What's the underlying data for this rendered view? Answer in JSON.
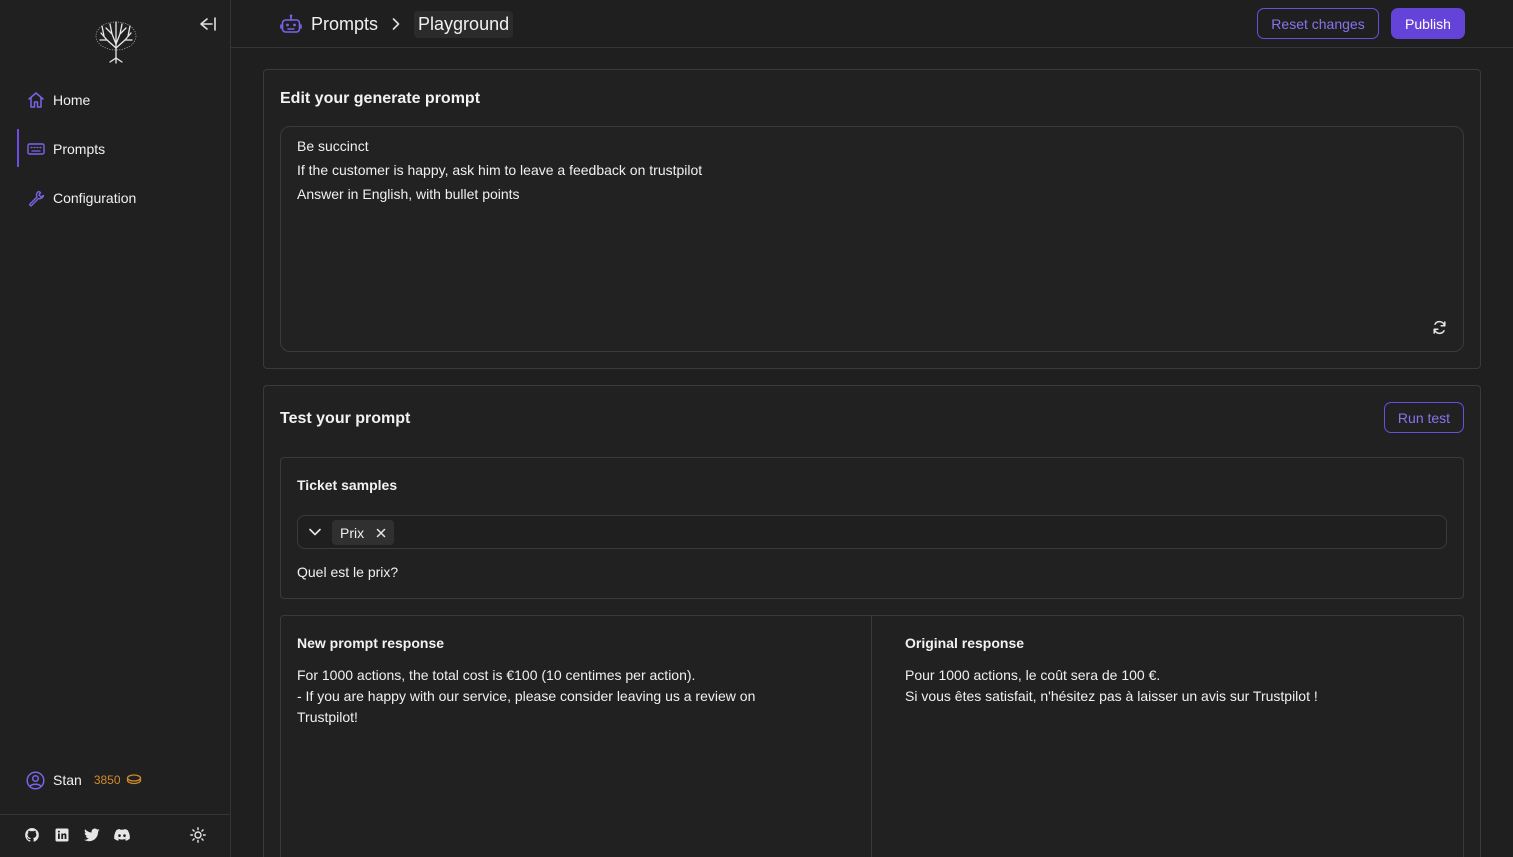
{
  "sidebar": {
    "nav": [
      {
        "label": "Home",
        "icon": "home-icon"
      },
      {
        "label": "Prompts",
        "icon": "keyboard-icon"
      },
      {
        "label": "Configuration",
        "icon": "wrench-icon"
      }
    ],
    "user": {
      "name": "Stan",
      "credits": "3850"
    }
  },
  "header": {
    "breadcrumb_root": "Prompts",
    "breadcrumb_current": "Playground",
    "reset_label": "Reset changes",
    "publish_label": "Publish"
  },
  "edit_card": {
    "title": "Edit your generate prompt",
    "lines": [
      "Be succinct",
      "If the customer is happy, ask him to leave a feedback on trustpilot",
      "Answer in English, with bullet points"
    ]
  },
  "test_card": {
    "title": "Test your prompt",
    "run_label": "Run test",
    "samples_title": "Ticket samples",
    "selected_chip": "Prix",
    "question": "Quel est le prix?",
    "new_title": "New prompt response",
    "new_lines": [
      "For 1000 actions, the total cost is €100 (10 centimes per action).",
      "- If you are happy with our service, please consider leaving us a review on",
      "Trustpilot!"
    ],
    "orig_title": "Original response",
    "orig_lines": [
      "Pour 1000 actions, le coût sera de 100 €.",
      "Si vous êtes satisfait, n'hésitez pas à laisser un avis sur Trustpilot !"
    ]
  },
  "colors": {
    "accent": "#6443d8",
    "accent_text": "#8a73ee",
    "credits": "#d08a2a"
  }
}
